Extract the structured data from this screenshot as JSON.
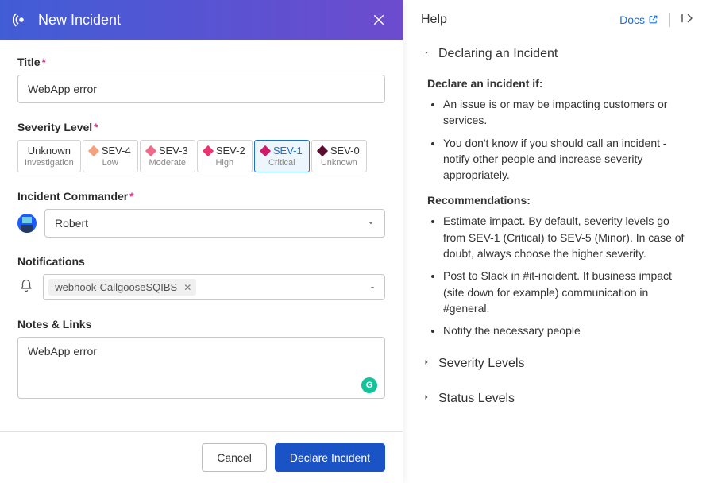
{
  "modal": {
    "title": "New Incident"
  },
  "form": {
    "title_label": "Title",
    "title_value": "WebApp error",
    "severity_label": "Severity Level",
    "severity_options": [
      {
        "name": "Unknown",
        "desc": "Investigation",
        "color": "#ffffff"
      },
      {
        "name": "SEV-4",
        "desc": "Low",
        "color": "#f2a27e"
      },
      {
        "name": "SEV-3",
        "desc": "Moderate",
        "color": "#ef6a8a"
      },
      {
        "name": "SEV-2",
        "desc": "High",
        "color": "#e8356f"
      },
      {
        "name": "SEV-1",
        "desc": "Critical",
        "color": "#d11a6b",
        "selected": true
      },
      {
        "name": "SEV-0",
        "desc": "Unknown",
        "color": "#5a0d2f"
      }
    ],
    "commander_label": "Incident Commander",
    "commander_value": "Robert",
    "notifications_label": "Notifications",
    "notification_tag": "webhook-CallgooseSQIBS",
    "notes_label": "Notes & Links",
    "notes_value": "WebApp error",
    "cancel_label": "Cancel",
    "submit_label": "Declare Incident"
  },
  "help": {
    "title": "Help",
    "docs_label": "Docs",
    "sections": {
      "declaring": {
        "title": "Declaring an Incident",
        "declare_heading": "Declare an incident if:",
        "declare_items": [
          "An issue is or may be impacting customers or services.",
          "You don't know if you should call an incident - notify other people and increase severity appropriately."
        ],
        "rec_heading": "Recommendations:",
        "rec_items": [
          "Estimate impact. By default, severity levels go from SEV-1 (Critical) to SEV-5 (Minor). In case of doubt, always choose the higher severity.",
          "Post to Slack in #it-incident. If business impact (site down for example) communication in #general.",
          "Notify the necessary people"
        ]
      },
      "severity_title": "Severity Levels",
      "status_title": "Status Levels"
    }
  }
}
